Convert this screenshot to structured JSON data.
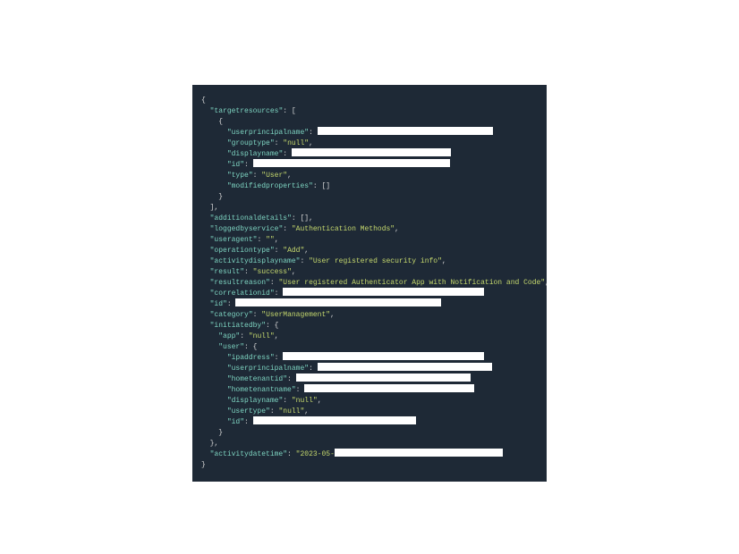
{
  "code": {
    "keys": {
      "targetresources": "targetresources",
      "userprincipalname": "userprincipalname",
      "grouptype": "grouptype",
      "displayname": "displayname",
      "id": "id",
      "type": "type",
      "modifiedproperties": "modifiedproperties",
      "additionaldetails": "additionaldetails",
      "loggedbyservice": "loggedbyservice",
      "useragent": "useragent",
      "operationtype": "operationtype",
      "activitydisplayname": "activitydisplayname",
      "result": "result",
      "resultreason": "resultreason",
      "correlationid": "correlationid",
      "category": "category",
      "initiatedby": "initiatedby",
      "app": "app",
      "user": "user",
      "ipaddress": "ipaddress",
      "hometenantid": "hometenantid",
      "hometenantname": "hometenantname",
      "usertype": "usertype",
      "activitydatetime": "activitydatetime"
    },
    "values": {
      "grouptype": "null",
      "type": "User",
      "loggedbyservice": "Authentication Methods",
      "useragent": "",
      "operationtype": "Add",
      "activitydisplayname": "User registered security info",
      "result": "success",
      "resultreason": "User registered Authenticator App with Notification and Code",
      "category": "UserManagement",
      "app": "null",
      "displayname_null": "null",
      "usertype": "null",
      "activitydatetime_prefix": "2023-05-"
    },
    "redacted_widths": {
      "upn1": 196,
      "displayname1": 178,
      "id1": 220,
      "correlationid": 225,
      "id2": 230,
      "ipaddress": 225,
      "upn2": 195,
      "hometenantid": 195,
      "hometenantname": 190,
      "id3": 182,
      "datetime": 188
    }
  }
}
